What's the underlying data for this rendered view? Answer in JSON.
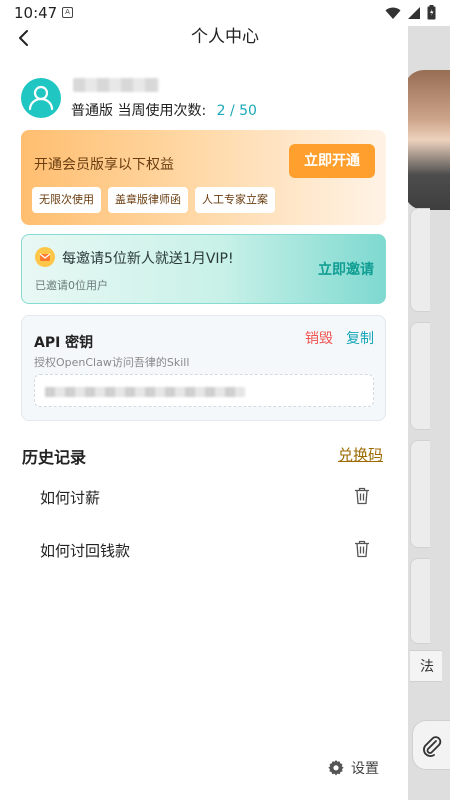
{
  "status_bar": {
    "time": "10:47",
    "notification_icon": "A"
  },
  "header": {
    "title": "个人中心"
  },
  "user": {
    "plan": "普通版",
    "usage_label": "当周使用次数:",
    "usage_count": "2 / 50"
  },
  "membership": {
    "title": "开通会员版享以下权益",
    "button_label": "立即开通",
    "perks": [
      "无限次使用",
      "盖章版律师函",
      "人工专家立案"
    ]
  },
  "invite": {
    "title": "每邀请5位新人就送1月VIP!",
    "subtitle": "已邀请0位用户",
    "button_label": "立即邀请"
  },
  "api_key": {
    "title": "API 密钥",
    "revoke_label": "销毁",
    "copy_label": "复制",
    "description": "授权OpenClaw访问吾律的Skill"
  },
  "history": {
    "title": "历史记录",
    "redeem_label": "兑换码",
    "items": [
      {
        "label": "如何讨薪"
      },
      {
        "label": "如何讨回钱款"
      }
    ]
  },
  "settings": {
    "label": "设置"
  },
  "background": {
    "partial_text": "法"
  },
  "colors": {
    "accent_teal": "#1aa9b8",
    "member_orange": "#ffa02e",
    "danger_red": "#ef5350",
    "redeem_gold": "#9c6a00"
  }
}
